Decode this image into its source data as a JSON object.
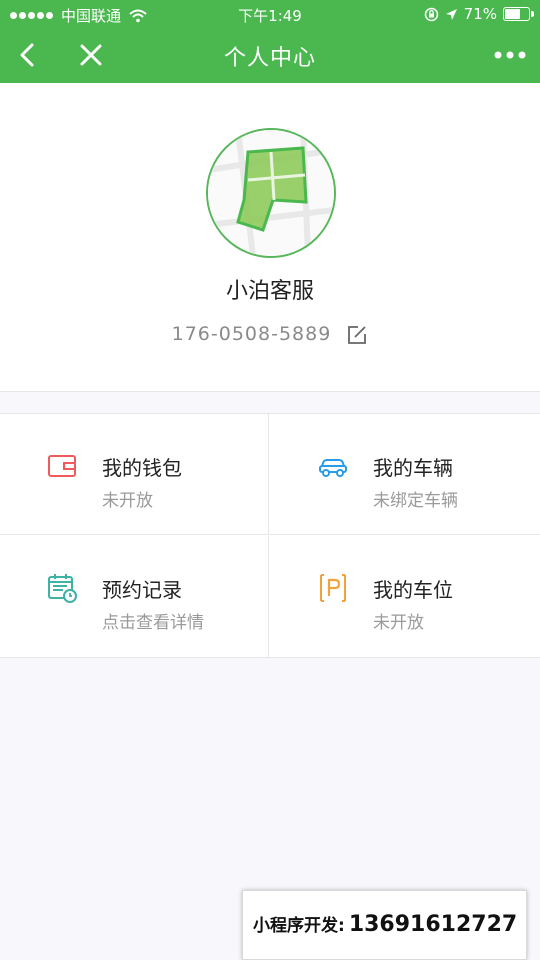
{
  "status_bar": {
    "carrier": "中国联通",
    "time": "下午1:49",
    "battery_text": "71%",
    "battery_level": 0.71
  },
  "nav": {
    "title": "个人中心"
  },
  "profile": {
    "name": "小泊客服",
    "phone": "176-0508-5889"
  },
  "menu": [
    {
      "label": "我的钱包",
      "sub": "未开放",
      "icon": "wallet-icon",
      "color": "#f05a5a"
    },
    {
      "label": "我的车辆",
      "sub": "未绑定车辆",
      "icon": "car-icon",
      "color": "#2a9be6"
    },
    {
      "label": "预约记录",
      "sub": "点击查看详情",
      "icon": "calendar-clock-icon",
      "color": "#3fb2a4"
    },
    {
      "label": "我的车位",
      "sub": "未开放",
      "icon": "parking-icon",
      "color": "#f0a23c"
    }
  ],
  "promo": {
    "label": "小程序开发:",
    "number": "13691612727"
  },
  "colors": {
    "brand_green": "#4ab84f",
    "background": "#f8f7fb"
  }
}
